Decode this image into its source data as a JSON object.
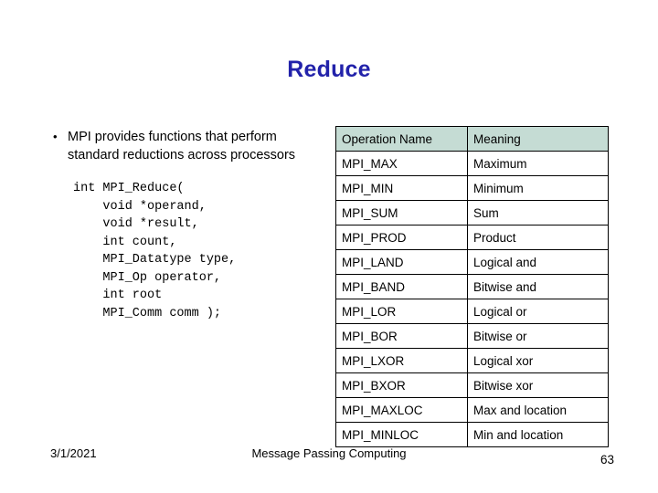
{
  "slide": {
    "title": "Reduce",
    "bullet": {
      "marker": "•",
      "text": "MPI provides functions that perform standard reductions across processors"
    },
    "code_lines": [
      "int MPI_Reduce(",
      "    void *operand,",
      "    void *result,",
      "    int count,",
      "    MPI_Datatype type,",
      "    MPI_Op operator,",
      "    int root",
      "    MPI_Comm comm );"
    ],
    "table": {
      "headers": [
        "Operation Name",
        "Meaning"
      ],
      "header_bg": "#c5dcd4",
      "rows": [
        [
          "MPI_MAX",
          "Maximum"
        ],
        [
          "MPI_MIN",
          "Minimum"
        ],
        [
          "MPI_SUM",
          "Sum"
        ],
        [
          "MPI_PROD",
          "Product"
        ],
        [
          "MPI_LAND",
          "Logical and"
        ],
        [
          "MPI_BAND",
          "Bitwise and"
        ],
        [
          "MPI_LOR",
          "Logical or"
        ],
        [
          "MPI_BOR",
          "Bitwise or"
        ],
        [
          "MPI_LXOR",
          "Logical xor"
        ],
        [
          "MPI_BXOR",
          "Bitwise xor"
        ],
        [
          "MPI_MAXLOC",
          "Max and location"
        ],
        [
          "MPI_MINLOC",
          "Min and location"
        ]
      ]
    },
    "footer": {
      "date": "3/1/2021",
      "center": "Message Passing Computing",
      "page": "63"
    }
  }
}
